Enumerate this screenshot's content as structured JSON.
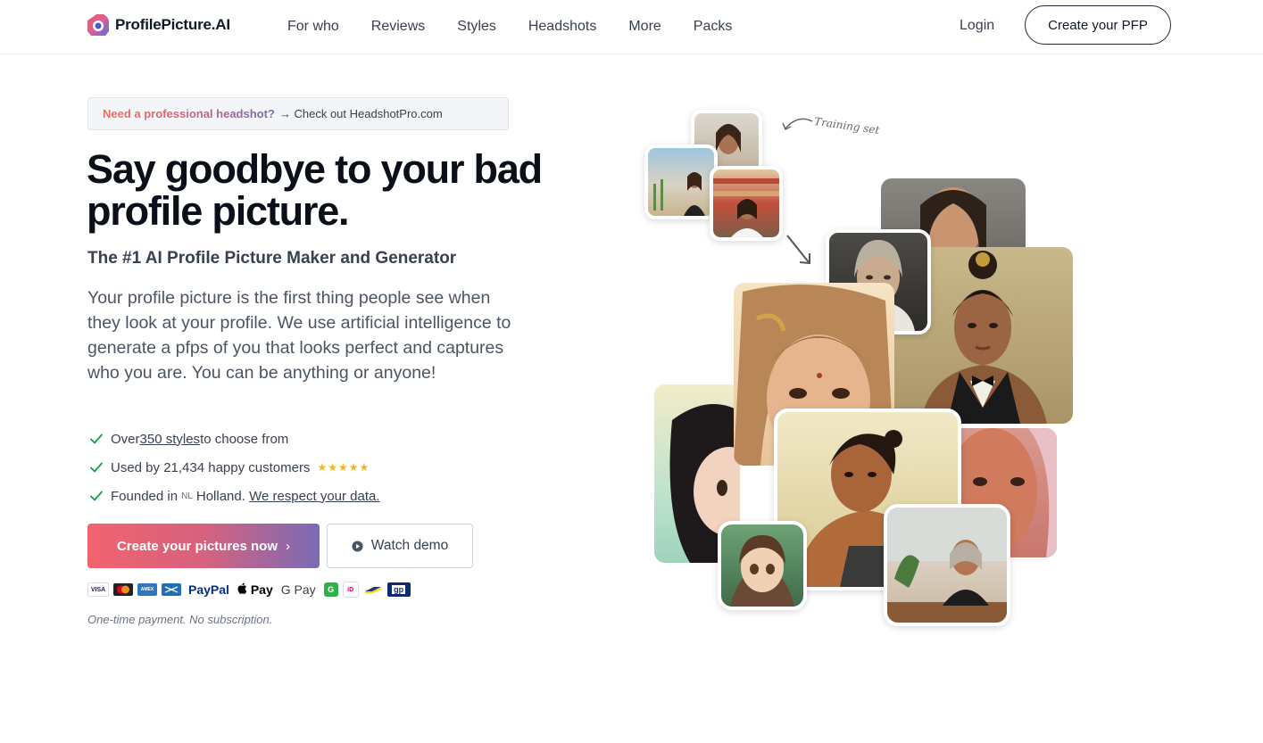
{
  "header": {
    "brand": "ProfilePicture.AI",
    "nav": [
      "For who",
      "Reviews",
      "Styles",
      "Headshots",
      "More",
      "Packs"
    ],
    "login": "Login",
    "cta": "Create your PFP"
  },
  "banner": {
    "strong": "Need a professional headshot?",
    "rest": "→ Check out HeadshotPro.com"
  },
  "hero": {
    "title": "Say goodbye to your bad profile picture.",
    "subtitle": "The #1 AI Profile Picture Maker and Generator",
    "description": "Your profile picture is the first thing people see when they look at your profile. We use artificial intelligence to generate a pfps of you that looks perfect and captures who you are. You can be anything or anyone!"
  },
  "features": {
    "f1": {
      "pre": "Over ",
      "link": "350 styles ",
      "post": "to choose from"
    },
    "f2": {
      "text": "Used by 21,434 happy customers",
      "stars": "★★★★★",
      "rating": 5
    },
    "f3": {
      "pre": "Founded in ",
      "flag": "NL",
      "place": "Holland.",
      "link": "We respect your data."
    }
  },
  "buttons": {
    "primary": "Create your pictures now",
    "primary_chevron": "›",
    "secondary": "Watch demo"
  },
  "payments": {
    "visa": "VISA",
    "amex": "AMEX",
    "paypal": "PayPal",
    "apple": "Pay",
    "google": "G Pay",
    "gp": "gp"
  },
  "footnote": "One-time payment. No subscription.",
  "collage": {
    "training_label": "Training set"
  },
  "colors": {
    "accent_start": "#f2636e",
    "accent_end": "#7a6bb5",
    "check": "#16a34a",
    "star": "#f5b51b"
  }
}
